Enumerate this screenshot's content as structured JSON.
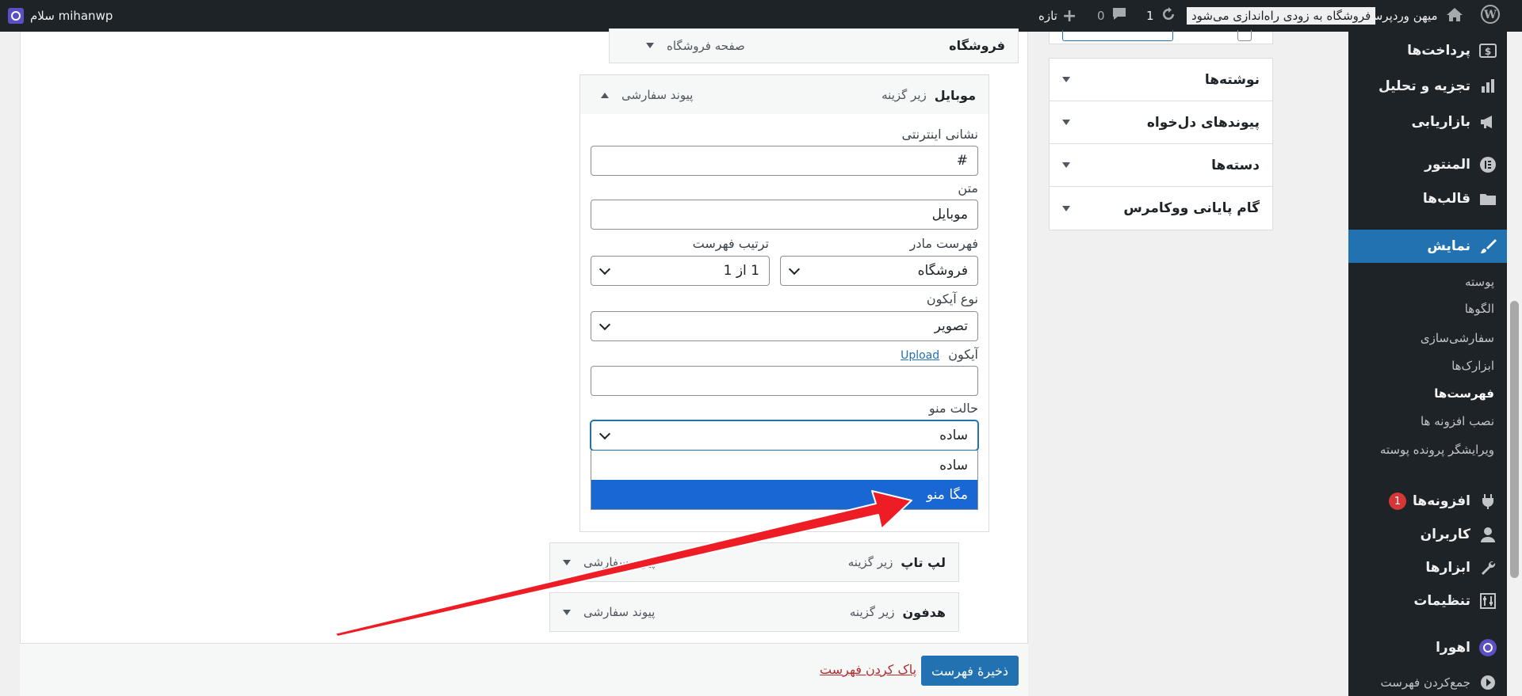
{
  "adminbar": {
    "greeting": "سلام mihanwp",
    "site_name": "میهن وردپرس",
    "store_notice": "فروشگاه به زودی راه‌اندازی می‌شود",
    "updates_count": "1",
    "comments_count": "0",
    "new_label": "تازه"
  },
  "sidebar": {
    "payments": "پرداخت‌ها",
    "analytics": "تجزیه و تحلیل",
    "marketing": "بازاریابی",
    "elementor": "المنتور",
    "templates": "قالب‌ها",
    "appearance": "نمایش",
    "submenu": [
      "پوسته",
      "الگوها",
      "سفارشی‌سازی",
      "ابزارک‌ها",
      "فهرست‌ها",
      "نصب افزونه ها",
      "ویرایشگر پرونده پوسته"
    ],
    "plugins": "افزونه‌ها",
    "plugins_badge": "1",
    "users": "کاربران",
    "tools": "ابزارها",
    "settings": "تنظیمات",
    "ahura": "اهورا",
    "collapse": "جمع‌کردن فهرست"
  },
  "accordion": {
    "posts": "نوشته‌ها",
    "custom_links": "پیوندهای دل‌خواه",
    "categories": "دسته‌ها",
    "woo_endpoints": "گام پایانی ووکامرس"
  },
  "menu_items": {
    "shop": {
      "title": "فروشگاه",
      "type": "صفحه فروشگاه"
    },
    "mobile": {
      "title": "موبایل",
      "subtitle": "زیر گزینه",
      "type": "پیوند سفارشی"
    },
    "laptop": {
      "title": "لپ تاپ",
      "subtitle": "زیر گزینه",
      "type": "پیوند سفارشی"
    },
    "headphone": {
      "title": "هدفون",
      "subtitle": "زیر گزینه",
      "type": "پیوند سفارشی"
    }
  },
  "mobile_settings": {
    "url_label": "نشانی اینترنتی",
    "url_value": "#",
    "text_label": "متن",
    "text_value": "موبایل",
    "parent_label": "فهرست مادر",
    "parent_value": "فروشگاه",
    "order_label": "ترتیب فهرست",
    "order_value": "1 از 1",
    "icon_type_label": "نوع آیکون",
    "icon_type_value": "تصویر",
    "icon_label": "آیکون",
    "upload_link": "Upload",
    "icon_value": "",
    "menu_mode_label": "حالت منو",
    "menu_mode_value": "ساده",
    "menu_mode_options": [
      "ساده",
      "مگا منو"
    ]
  },
  "footer": {
    "save_label": "ذخیرهٔ فهرست",
    "delete_label": "پاک کردن فهرست"
  },
  "colors": {
    "admin_dark": "#1d2327",
    "accent": "#2271b1",
    "highlight": "#1967d2",
    "annotation_arrow": "#ee1c24"
  }
}
